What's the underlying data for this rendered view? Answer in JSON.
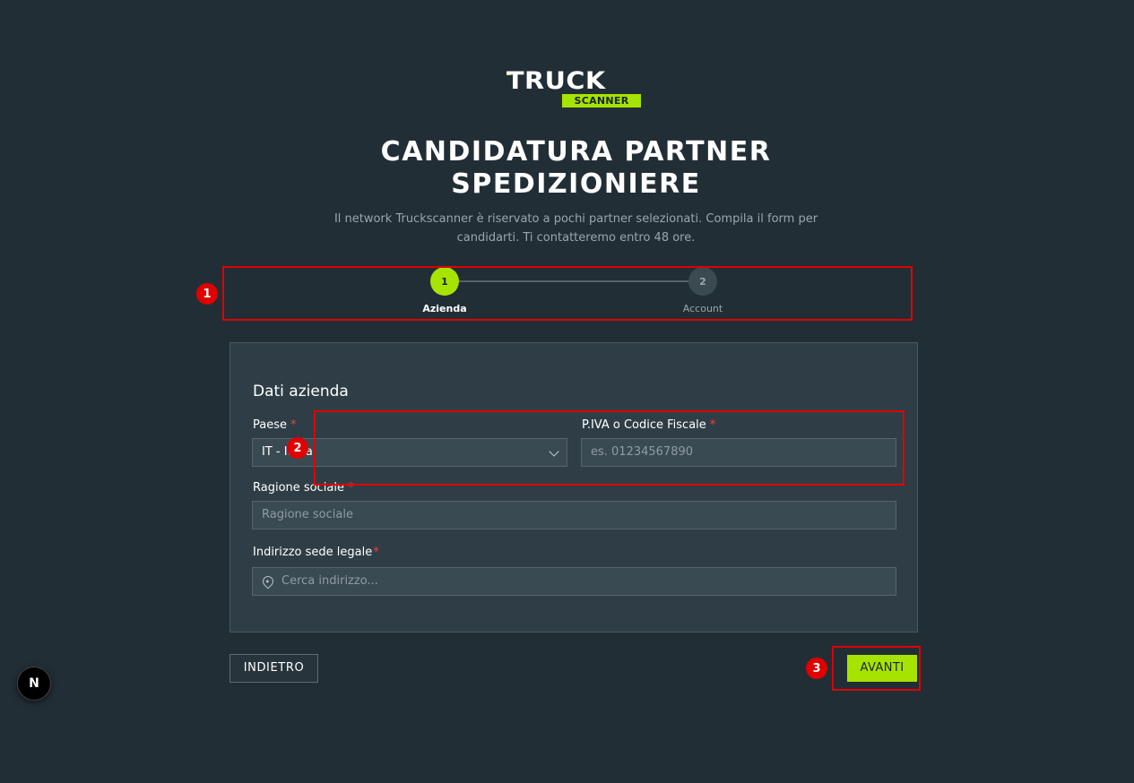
{
  "logo": {
    "word1": "TRUCK",
    "word2": "SCANNER"
  },
  "header": {
    "title_line1": "CANDIDATURA PARTNER",
    "title_line2": "SPEDIZIONIERE",
    "subtitle": "Il network Truckscanner è riservato a pochi partner selezionati. Compila il form per candidarti. Ti contatteremo entro 48 ore."
  },
  "stepper": {
    "steps": [
      {
        "number": "1",
        "label": "Azienda",
        "state": "active"
      },
      {
        "number": "2",
        "label": "Account",
        "state": "inactive"
      }
    ]
  },
  "form": {
    "section_title": "Dati azienda",
    "country": {
      "label": "Paese",
      "required_mark": "*",
      "value": "IT - Italia"
    },
    "vat": {
      "label": "P.IVA o Codice Fiscale",
      "required_mark": "*",
      "placeholder": "es. 01234567890"
    },
    "company_name": {
      "label": "Ragione sociale",
      "required_mark": "*",
      "placeholder": "Ragione sociale"
    },
    "address": {
      "label": "Indirizzo sede legale",
      "required_mark": "*",
      "placeholder": "Cerca indirizzo..."
    }
  },
  "actions": {
    "back_label": "INDIETRO",
    "next_label": "AVANTI"
  },
  "annotations": [
    "1",
    "2",
    "3"
  ],
  "dev_badge": "N",
  "colors": {
    "background": "#222e36",
    "card": "#2f3e46",
    "accent": "#a6e400",
    "annotation": "#e00000"
  }
}
